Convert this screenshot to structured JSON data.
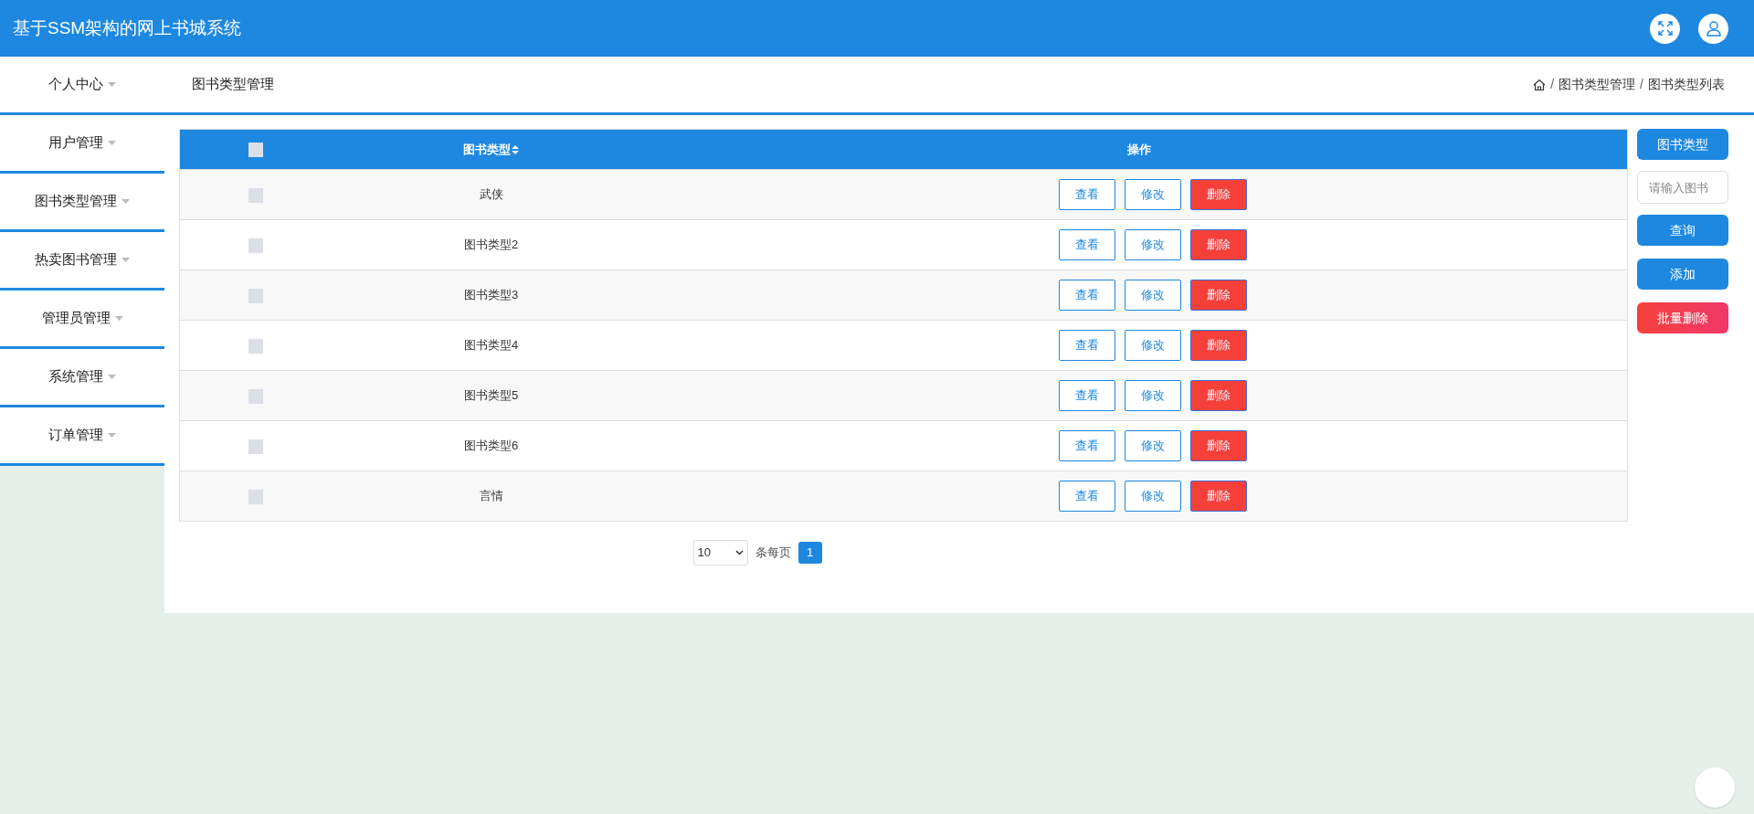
{
  "header": {
    "title": "基于SSM架构的网上书城系统"
  },
  "sidebar": {
    "items": [
      {
        "label": "个人中心",
        "expanded": false
      },
      {
        "label": "用户管理",
        "expanded": false
      },
      {
        "label": "图书类型管理",
        "expanded": false
      },
      {
        "label": "热卖图书管理",
        "expanded": false
      },
      {
        "label": "管理员管理",
        "expanded": false
      },
      {
        "label": "系统管理",
        "expanded": false
      },
      {
        "label": "订单管理",
        "expanded": false
      }
    ]
  },
  "page_title": "图书类型管理",
  "breadcrumb": [
    {
      "separator": "/",
      "label": "图书类型管理"
    },
    {
      "separator": "/",
      "label": "图书类型列表"
    }
  ],
  "table": {
    "columns": [
      "图书类型",
      "操作"
    ],
    "select_all_checked": false,
    "rows": [
      {
        "type": "武侠",
        "checked": false,
        "actions": [
          {
            "label": "查看",
            "kind": "outline"
          },
          {
            "label": "修改",
            "kind": "outline"
          },
          {
            "label": "删除",
            "kind": "danger"
          }
        ]
      },
      {
        "type": "图书类型2",
        "checked": false,
        "actions": [
          {
            "label": "查看",
            "kind": "outline"
          },
          {
            "label": "修改",
            "kind": "outline"
          },
          {
            "label": "删除",
            "kind": "danger"
          }
        ]
      },
      {
        "type": "图书类型3",
        "checked": false,
        "actions": [
          {
            "label": "查看",
            "kind": "outline"
          },
          {
            "label": "修改",
            "kind": "outline"
          },
          {
            "label": "删除",
            "kind": "danger"
          }
        ]
      },
      {
        "type": "图书类型4",
        "checked": false,
        "actions": [
          {
            "label": "查看",
            "kind": "outline"
          },
          {
            "label": "修改",
            "kind": "outline"
          },
          {
            "label": "删除",
            "kind": "danger"
          }
        ]
      },
      {
        "type": "图书类型5",
        "checked": false,
        "actions": [
          {
            "label": "查看",
            "kind": "outline"
          },
          {
            "label": "修改",
            "kind": "outline"
          },
          {
            "label": "删除",
            "kind": "danger"
          }
        ]
      },
      {
        "type": "图书类型6",
        "checked": false,
        "actions": [
          {
            "label": "查看",
            "kind": "outline"
          },
          {
            "label": "修改",
            "kind": "outline"
          },
          {
            "label": "删除",
            "kind": "danger"
          }
        ]
      },
      {
        "type": "言情",
        "checked": false,
        "actions": [
          {
            "label": "查看",
            "kind": "outline"
          },
          {
            "label": "修改",
            "kind": "outline"
          },
          {
            "label": "删除",
            "kind": "danger"
          }
        ]
      }
    ]
  },
  "pagination": {
    "page_size": "10",
    "page_size_label": "条每页",
    "pages": [
      {
        "label": "1",
        "selected": true
      }
    ]
  },
  "search_panel": {
    "label": "图书类型",
    "placeholder": "请输入图书",
    "buttons": [
      {
        "label": "查询",
        "kind": "primary"
      },
      {
        "label": "添加",
        "kind": "primary"
      },
      {
        "label": "批量删除",
        "kind": "danger"
      }
    ]
  }
}
